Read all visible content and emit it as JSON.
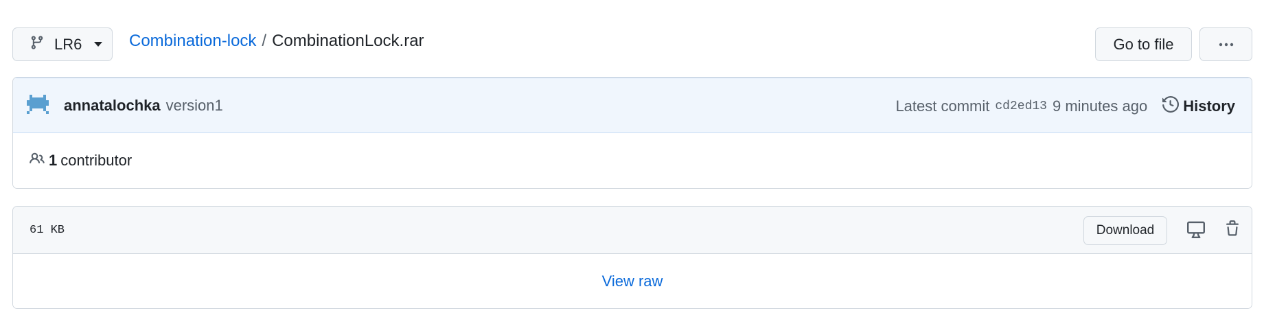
{
  "branch": {
    "name": "LR6",
    "icon": "git-branch-icon"
  },
  "breadcrumb": {
    "repo": "Combination-lock",
    "separator": "/",
    "file": "CombinationLock.rar"
  },
  "header_actions": {
    "goto_label": "Go to file",
    "more_icon": "kebab-horizontal-icon"
  },
  "commit": {
    "author": "annatalochka",
    "message": "version1",
    "latest_label": "Latest commit",
    "sha": "cd2ed13",
    "time": "9 minutes ago",
    "history_label": "History",
    "avatar_color": "#5a9fd0"
  },
  "contributors": {
    "count": "1",
    "label": "contributor"
  },
  "file": {
    "size": "61 KB",
    "download_label": "Download",
    "view_raw_label": "View raw"
  },
  "colors": {
    "link": "#0969da",
    "commit_bg": "#f0f6fd",
    "border": "#d0d7de",
    "button_bg": "#f6f8fa"
  }
}
